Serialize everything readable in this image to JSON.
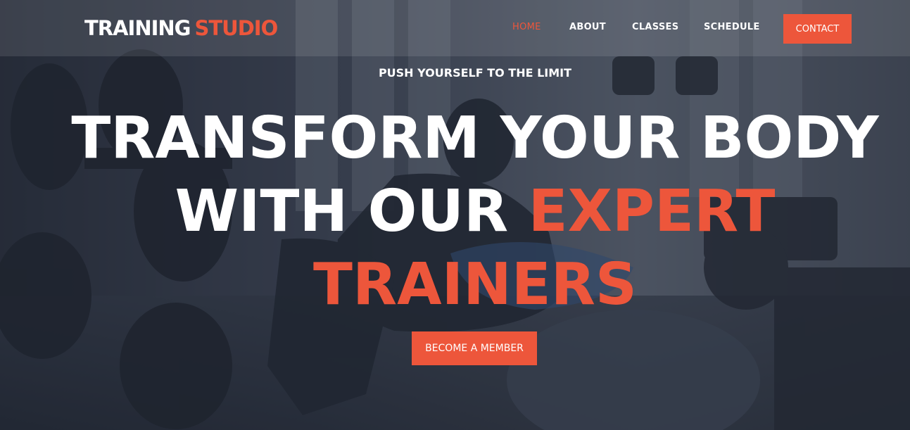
{
  "header": {
    "logo": {
      "part1": "TRAINING",
      "part2": "STUDIO"
    },
    "nav": [
      {
        "label": "HOME",
        "active": true
      },
      {
        "label": "ABOUT",
        "active": false
      },
      {
        "label": "CLASSES",
        "active": false
      },
      {
        "label": "SCHEDULE",
        "active": false
      }
    ],
    "contact_label": "CONTACT"
  },
  "hero": {
    "tagline": "PUSH YOURSELF TO THE LIMIT",
    "headline": {
      "line1": "TRANSFORM YOUR BODY",
      "line2_white": "WITH OUR",
      "line2_accent": "EXPERT",
      "line3_accent": "TRAINERS"
    },
    "cta_label": "BECOME A MEMBER"
  },
  "colors": {
    "accent": "#ed563b",
    "text": "#ffffff",
    "overlay": "#232a38"
  }
}
